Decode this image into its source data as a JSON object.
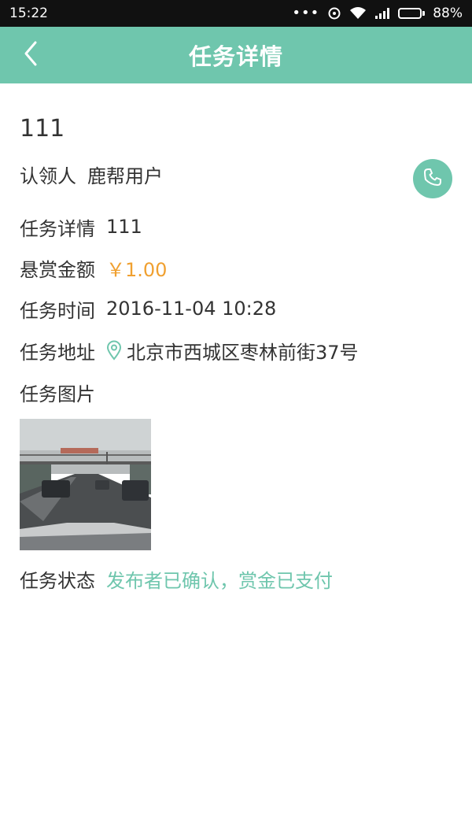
{
  "status_bar": {
    "time": "15:22",
    "dots": "•••",
    "battery_text": "88%",
    "battery_level": 0.88,
    "icons": [
      "alarm-icon",
      "wifi-icon",
      "signal-icon",
      "battery-icon"
    ]
  },
  "header": {
    "title": "任务详情",
    "back_icon": "chevron-left-icon",
    "background": "#6fc6ad"
  },
  "task": {
    "title": "111",
    "claimant_label": "认领人",
    "claimant_value": "鹿帮用户",
    "detail_label": "任务详情",
    "detail_value": "111",
    "reward_label": "悬赏金额",
    "reward_value": "￥1.00",
    "time_label": "任务时间",
    "time_value": "2016-11-04 10:28",
    "address_label": "任务地址",
    "address_value": "北京市西城区枣林前街37号",
    "image_label": "任务图片",
    "status_label": "任务状态",
    "status_value": "发布者已确认，赏金已支付"
  },
  "colors": {
    "accent": "#6fc6ad",
    "reward": "#f0a030",
    "text": "#333333"
  }
}
